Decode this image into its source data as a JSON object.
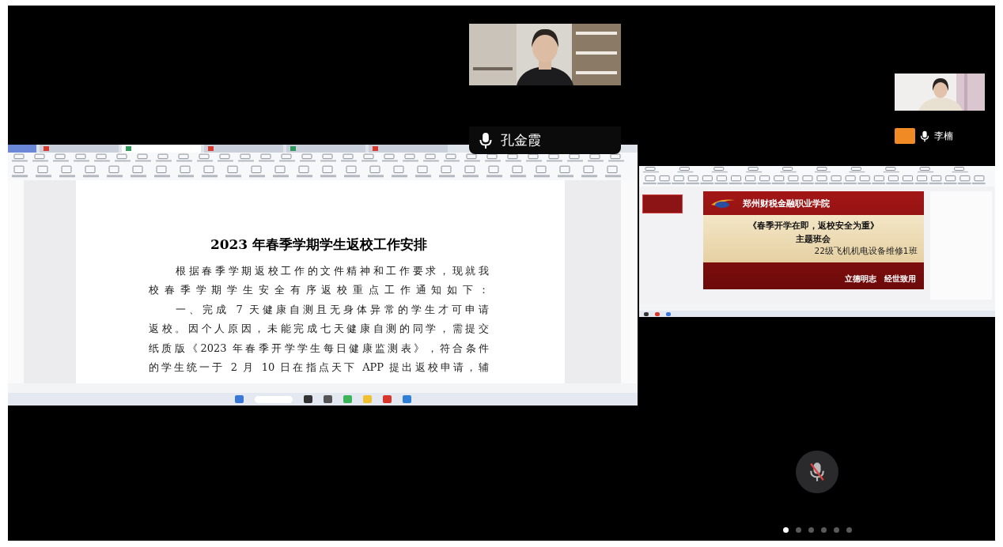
{
  "participants": [
    {
      "name": "孔金霞",
      "kind": "main"
    },
    {
      "name": "李楠",
      "kind": "side"
    }
  ],
  "shared_document": {
    "tabs": [
      {
        "kind": "home",
        "selected": false
      },
      {
        "kind": "file",
        "selected": false
      },
      {
        "kind": "file",
        "selected": true
      },
      {
        "kind": "file",
        "selected": false
      },
      {
        "kind": "file",
        "selected": false
      },
      {
        "kind": "file",
        "selected": false
      }
    ],
    "title": "2023 年春季学期学生返校工作安排",
    "lines": [
      {
        "text": "根据春季学期返校工作的文件精神和工作要求，现就我",
        "indent": true
      },
      {
        "text": "校春季学期学生安全有序返校重点工作通知如下：",
        "indent": false
      },
      {
        "text": "一、完成 7 天健康自测且无身体异常的学生才可申请",
        "indent": true
      },
      {
        "text": "返校。因个人原因，未能完成七天健康自测的同学，需提交",
        "indent": false
      },
      {
        "text": "纸质版《2023 年春季开学学生每日健康监测表》，符合条件",
        "indent": false
      },
      {
        "text": "的学生统一于 2 月 10 日在指点天下 APP 提出返校申请，辅",
        "indent": false
      }
    ]
  },
  "shared_slide": {
    "school": "郑州财税金融职业学院",
    "title": "《春季开学在即，返校安全为重》",
    "subtitle": "主题班会",
    "class_name": "22级飞机机电设备维修1班",
    "motto": "立德明志　经世致用"
  },
  "mic": {
    "muted": true
  },
  "pages": [
    {
      "selected": true
    },
    {
      "selected": false
    },
    {
      "selected": false
    },
    {
      "selected": false
    },
    {
      "selected": false
    },
    {
      "selected": false
    }
  ]
}
